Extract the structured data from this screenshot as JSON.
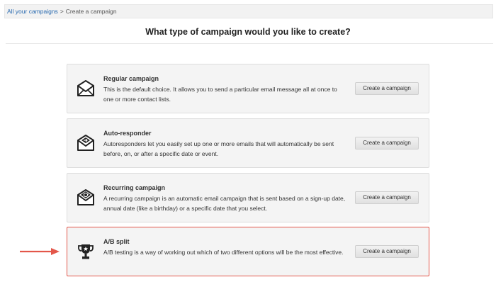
{
  "breadcrumb": {
    "link_label": "All your campaigns",
    "separator": ">",
    "current": "Create a campaign"
  },
  "page_title": "What type of campaign would you like to create?",
  "accent_color": "#e3574a",
  "cards": [
    {
      "title": "Regular campaign",
      "description": "This is the default choice. It allows you to send a particular email message all at once to one or more contact lists.",
      "button_label": "Create a campaign",
      "icon": "envelope-icon"
    },
    {
      "title": "Auto-responder",
      "description": "Autoresponders let you easily set up one or more emails that will automatically be sent before, on, or after a specific date or event.",
      "button_label": "Create a campaign",
      "icon": "envelope-arrow-icon"
    },
    {
      "title": "Recurring campaign",
      "description": "A recurring campaign is an automatic email campaign that is sent based on a sign-up date, annual date (like a birthday) or a specific date that you select.",
      "button_label": "Create a campaign",
      "icon": "envelope-recurring-icon"
    },
    {
      "title": "A/B split",
      "description": "A/B testing is a way of working out which of two different options will be the most effective.",
      "button_label": "Create a campaign",
      "icon": "trophy-icon",
      "highlighted": true
    }
  ]
}
